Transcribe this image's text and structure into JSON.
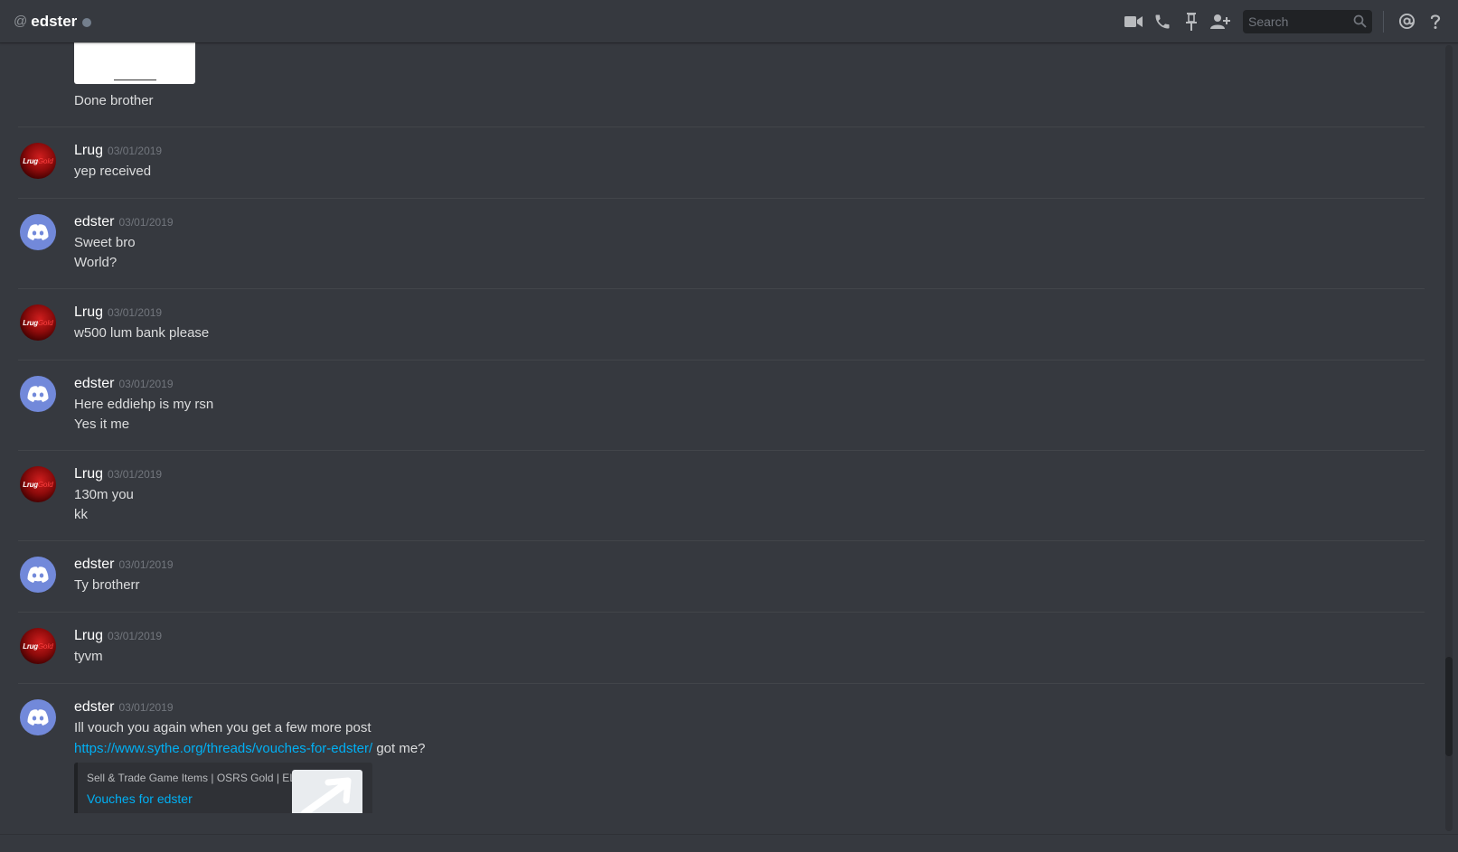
{
  "header": {
    "at_symbol": "@",
    "channel_name": "edster",
    "search_placeholder": "Search",
    "icons": [
      "video-call-icon",
      "voice-call-icon",
      "pin-icon",
      "add-friend-icon",
      "search-icon",
      "mention-icon",
      "help-icon"
    ]
  },
  "colors": {
    "background": "#36393f",
    "header_text": "#ffffff",
    "timestamp": "#72767d",
    "link": "#00b0f4",
    "status_offline": "#747f8d",
    "discord_blurple": "#7289da"
  },
  "messages": {
    "partial": {
      "text": "Done brother"
    },
    "groups": [
      {
        "author": "Lrug",
        "date": "03/01/2019",
        "lines": [
          "yep received"
        ]
      },
      {
        "author": "edster",
        "date": "03/01/2019",
        "lines": [
          "Sweet bro",
          "World?"
        ]
      },
      {
        "author": "Lrug",
        "date": "03/01/2019",
        "lines": [
          "w500 lum bank please"
        ]
      },
      {
        "author": "edster",
        "date": "03/01/2019",
        "lines": [
          "Here eddiehp is my rsn",
          "Yes it me"
        ]
      },
      {
        "author": "Lrug",
        "date": "03/01/2019",
        "lines": [
          "130m you",
          "kk"
        ]
      },
      {
        "author": "edster",
        "date": "03/01/2019",
        "lines": [
          "Ty brotherr"
        ]
      },
      {
        "author": "Lrug",
        "date": "03/01/2019",
        "lines": [
          "tyvm"
        ]
      },
      {
        "author": "edster",
        "date": "03/01/2019",
        "lines": [
          "Ill vouch you again when you get a few more post"
        ],
        "link": "https://www.sythe.org/threads/vouches-for-edster/",
        "link_suffix": " got me?",
        "embed": {
          "provider": "Sell & Trade Game Items | OSRS Gold | ELO",
          "title": "Vouches for edster"
        }
      }
    ]
  },
  "avatars": {
    "lrug_text_a": "Lrug",
    "lrug_text_b": "Gold"
  }
}
